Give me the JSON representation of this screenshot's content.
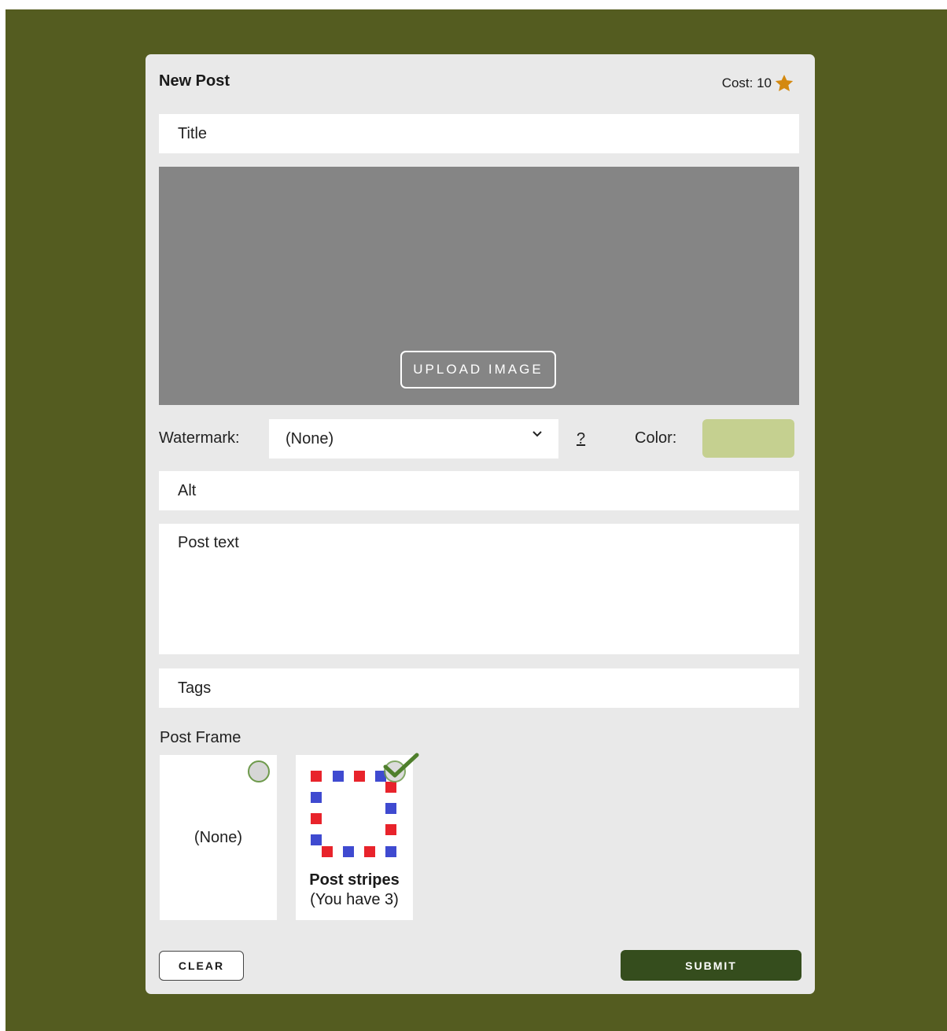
{
  "form": {
    "heading": "New Post",
    "cost_label": "Cost: 10",
    "cost_icon": "star-icon",
    "title_placeholder": "Title",
    "upload_label": "UPLOAD IMAGE",
    "watermark_label": "Watermark:",
    "watermark_value": "(None)",
    "help_label": "?",
    "color_label": "Color:",
    "color_value": "#c5d090",
    "alt_placeholder": "Alt",
    "post_text_placeholder": "Post text",
    "tags_placeholder": "Tags",
    "post_frame_label": "Post Frame",
    "frames": [
      {
        "label": "(None)",
        "selected": false
      },
      {
        "name": "Post stripes",
        "count_text": "(You have 3)",
        "selected": true
      }
    ],
    "clear_label": "CLEAR",
    "submit_label": "SUBMIT"
  },
  "colors": {
    "background": "#545c20",
    "card": "#e9e9e9",
    "submit": "#354d1d",
    "star": "#d4890f",
    "check": "#4f7f2c",
    "stripe_red": "#e8232b",
    "stripe_blue": "#3f4ad0"
  }
}
